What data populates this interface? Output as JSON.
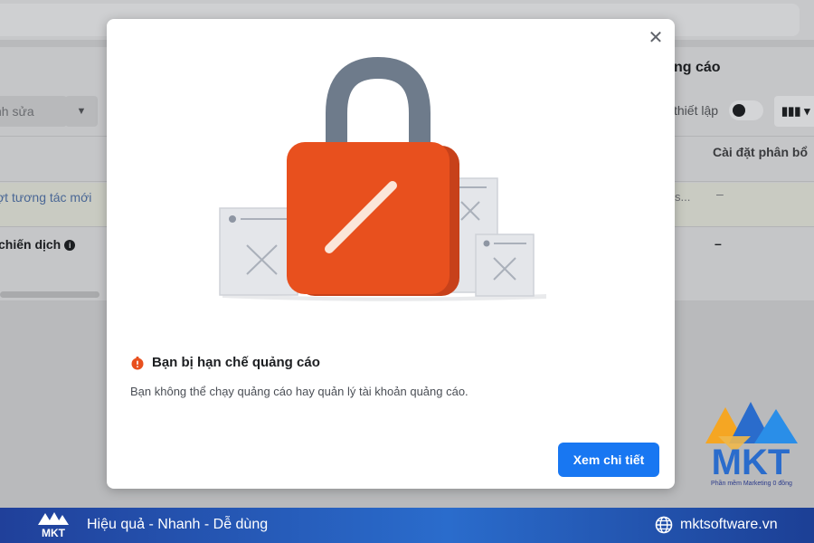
{
  "background": {
    "right_panel_title": "ng cáo",
    "edit_button_label": "nh sửa",
    "setup_label": "thiết lập",
    "column_header": "Cài đặt phân bổ",
    "row1_link_text": "ợt tương tác mới",
    "row1_truncated": "s...",
    "row1_dash": "–",
    "row2_bold_text": "chiến dịch",
    "row2_info_icon_glyph": "i",
    "row2_dash": "–"
  },
  "modal": {
    "close_icon": "close-icon",
    "heading": "Bạn bị hạn chế quảng cáo",
    "description": "Bạn không thể chạy quảng cáo hay quản lý tài khoản quảng cáo.",
    "primary_button_label": "Xem chi tiết",
    "colors": {
      "lock_body": "#e8501e",
      "lock_shackle": "#6e7b8b",
      "button": "#1877f2",
      "warning_icon": "#e8501e"
    }
  },
  "branding": {
    "logo_text": "MKT",
    "logo_subtext": "Phần mềm Marketing 0 đồng",
    "tagline": "Hiệu quả - Nhanh - Dễ dùng",
    "website": "mktsoftware.vn"
  }
}
